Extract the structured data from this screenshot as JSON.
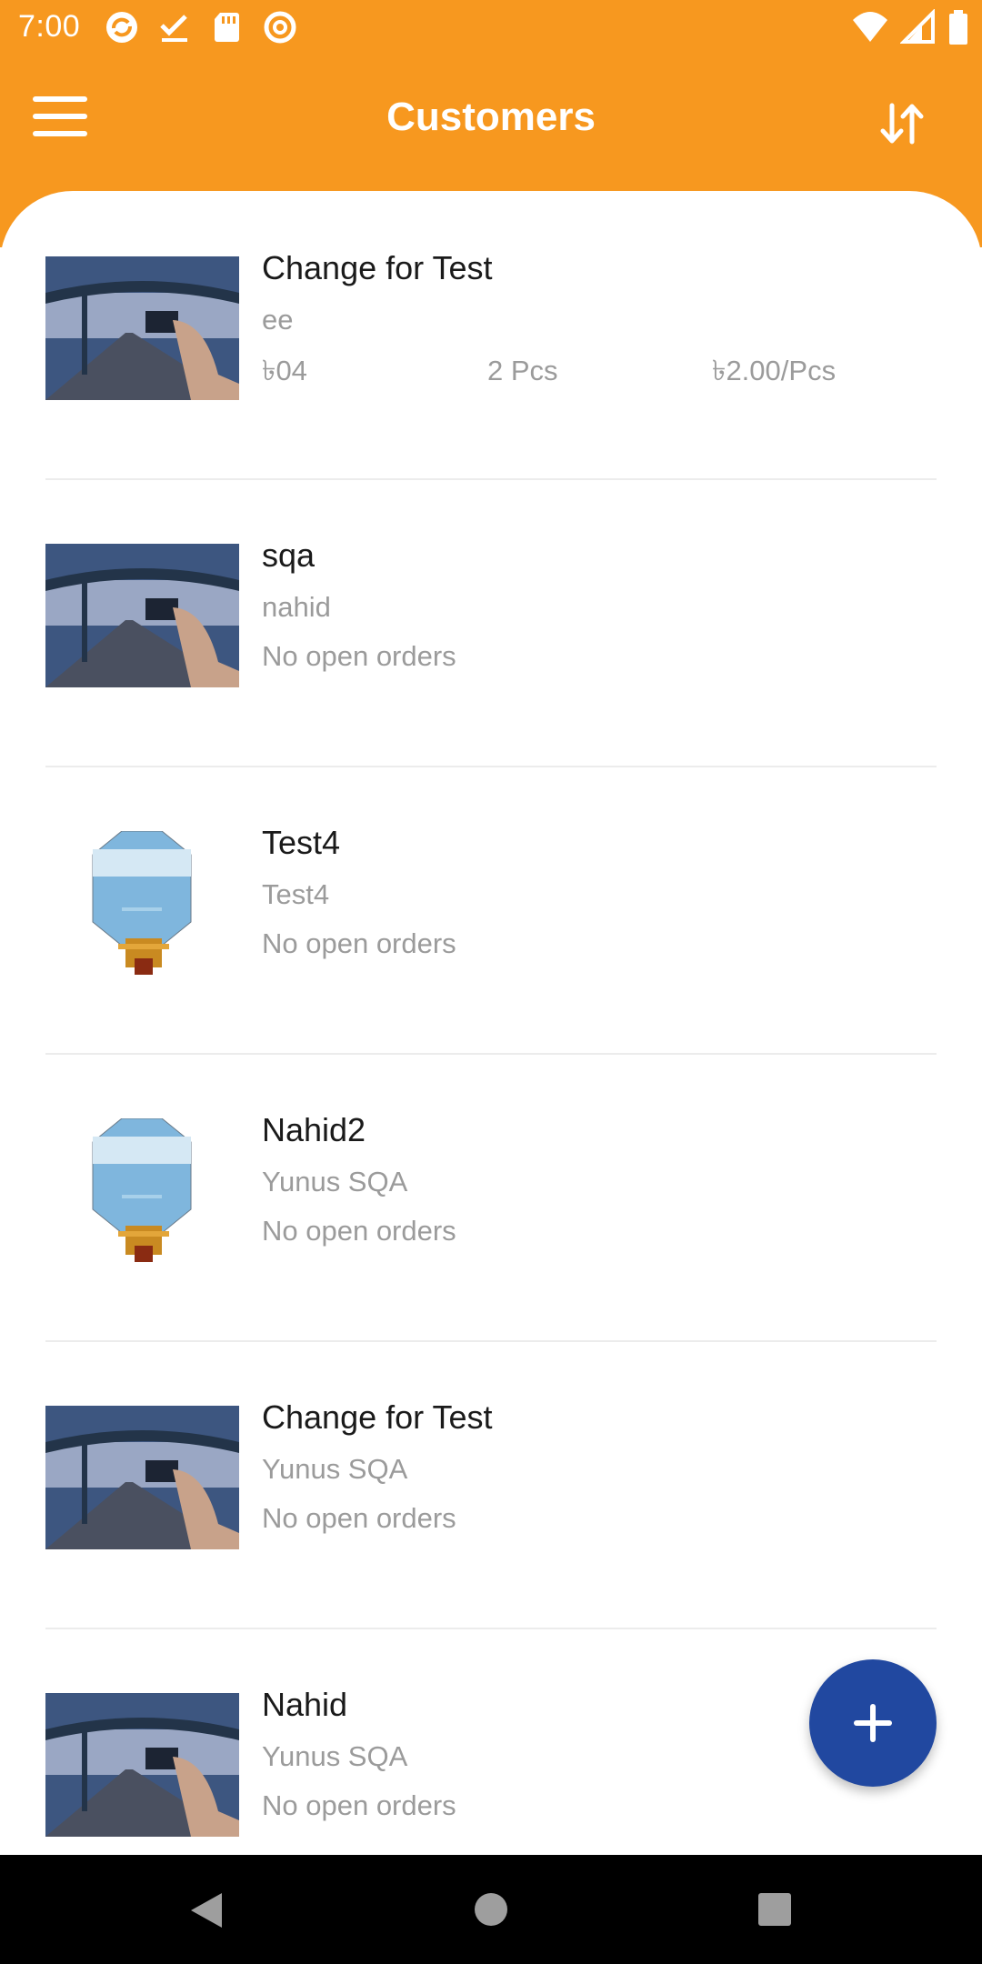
{
  "status_bar": {
    "time": "7:00"
  },
  "app_bar": {
    "title": "Customers",
    "menu_icon": "hamburger-menu-icon",
    "sort_icon": "sort-arrows-icon"
  },
  "customers": [
    {
      "name": "Change for Test",
      "subtitle": "ee",
      "amount": "৳04",
      "quantity": "2 Pcs",
      "unit_price": "৳2.00/Pcs",
      "thumb": "road-photo"
    },
    {
      "name": "sqa",
      "subtitle": "nahid",
      "orders_text": "No open orders",
      "thumb": "road-photo"
    },
    {
      "name": "Test4",
      "subtitle": "Test4",
      "orders_text": "No open orders",
      "thumb": "octagon-display"
    },
    {
      "name": "Nahid2",
      "subtitle": "Yunus SQA",
      "orders_text": "No open orders",
      "thumb": "octagon-display"
    },
    {
      "name": "Change for Test",
      "subtitle": "Yunus SQA",
      "orders_text": "No open orders",
      "thumb": "road-photo"
    },
    {
      "name": "Nahid",
      "subtitle": "Yunus SQA",
      "orders_text": "No open orders",
      "thumb": "road-photo"
    }
  ],
  "fab": {
    "icon": "plus-icon"
  },
  "colors": {
    "accent": "#F7981F",
    "fab": "#2148A0",
    "divider": "#ECECEC"
  }
}
